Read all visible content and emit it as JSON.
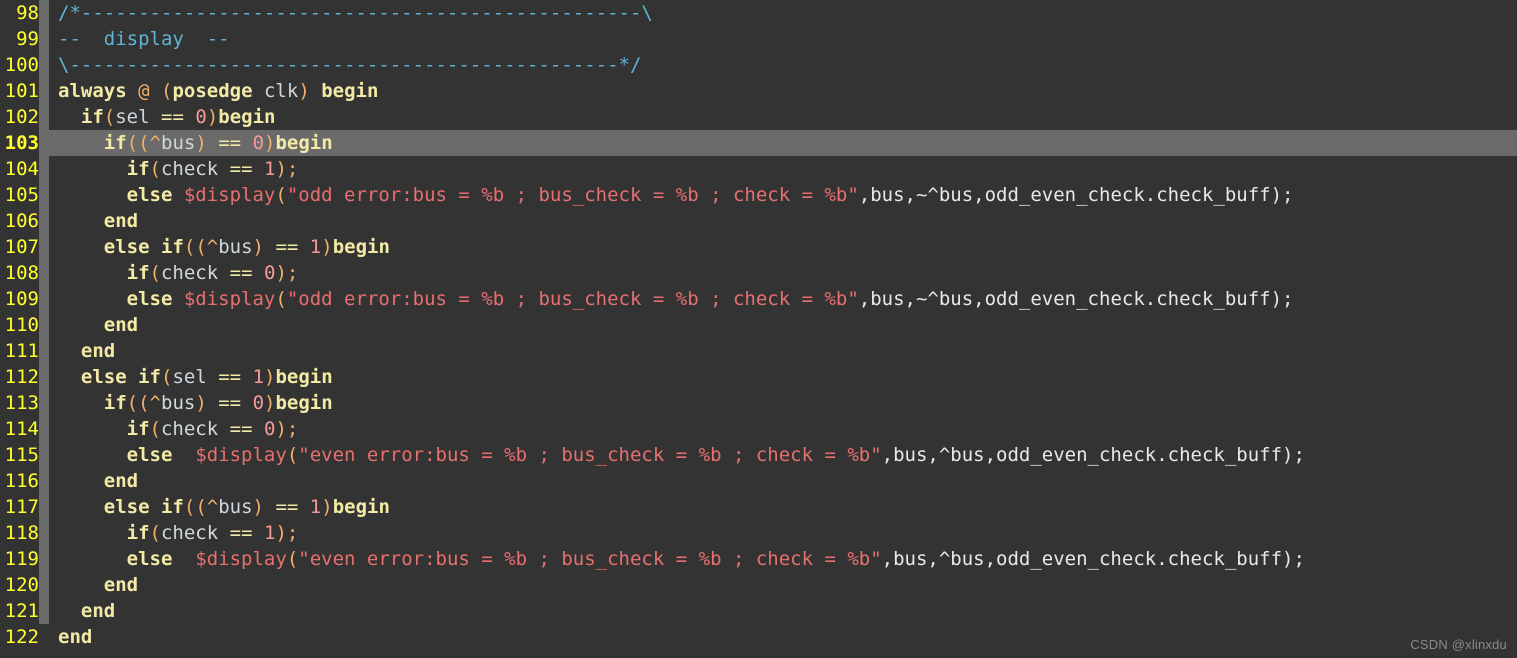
{
  "editor": {
    "title": "verilog-source-view",
    "language": "verilog",
    "first_line_number": 98,
    "current_line": 103,
    "colors": {
      "background": "#333333",
      "highlight_line": "#6a6a6a",
      "line_number": "#ffff2b",
      "fold_column": "#6a6a6a",
      "keyword": "#f3eaa5",
      "identifier": "#cfd8dc",
      "punctuation": "#f2b06a",
      "number": "#f59a9a",
      "string": "#e86f6f",
      "function": "#e86f6f",
      "comment": "#5fb3d4",
      "plain_text": "#e8e8e8",
      "watermark": "#8a8a8a"
    }
  },
  "watermark": {
    "text": "CSDN @xlinxdu"
  },
  "lines": [
    {
      "number": "98",
      "fold": true,
      "highlight": false,
      "tokens": [
        {
          "t": "/*-------------------------------------------------\\",
          "c": "cmt"
        }
      ]
    },
    {
      "number": "99",
      "fold": true,
      "highlight": false,
      "tokens": [
        {
          "t": "--  display  --",
          "c": "cmt"
        }
      ]
    },
    {
      "number": "100",
      "fold": true,
      "highlight": false,
      "tokens": [
        {
          "t": "\\------------------------------------------------*/",
          "c": "cmt"
        }
      ]
    },
    {
      "number": "101",
      "fold": true,
      "highlight": false,
      "tokens": [
        {
          "t": "always",
          "c": "kw"
        },
        {
          "t": " ",
          "c": "plain"
        },
        {
          "t": "@",
          "c": "at"
        },
        {
          "t": " ",
          "c": "plain"
        },
        {
          "t": "(",
          "c": "punc"
        },
        {
          "t": "posedge",
          "c": "kw"
        },
        {
          "t": " ",
          "c": "plain"
        },
        {
          "t": "clk",
          "c": "id"
        },
        {
          "t": ")",
          "c": "punc"
        },
        {
          "t": " ",
          "c": "plain"
        },
        {
          "t": "begin",
          "c": "kw"
        }
      ]
    },
    {
      "number": "102",
      "fold": true,
      "highlight": false,
      "tokens": [
        {
          "t": "  ",
          "c": "plain"
        },
        {
          "t": "if",
          "c": "kw"
        },
        {
          "t": "(",
          "c": "punc"
        },
        {
          "t": "sel",
          "c": "id"
        },
        {
          "t": " ",
          "c": "plain"
        },
        {
          "t": "==",
          "c": "op"
        },
        {
          "t": " ",
          "c": "plain"
        },
        {
          "t": "0",
          "c": "num"
        },
        {
          "t": ")",
          "c": "punc"
        },
        {
          "t": "begin",
          "c": "kw"
        }
      ]
    },
    {
      "number": "103",
      "fold": true,
      "highlight": true,
      "tokens": [
        {
          "t": "    ",
          "c": "plain"
        },
        {
          "t": "if",
          "c": "kw"
        },
        {
          "t": "((",
          "c": "punc"
        },
        {
          "t": "^",
          "c": "punc"
        },
        {
          "t": "bus",
          "c": "id"
        },
        {
          "t": ")",
          "c": "punc"
        },
        {
          "t": " ",
          "c": "plain"
        },
        {
          "t": "==",
          "c": "op"
        },
        {
          "t": " ",
          "c": "plain"
        },
        {
          "t": "0",
          "c": "num"
        },
        {
          "t": ")",
          "c": "punc"
        },
        {
          "t": "begin",
          "c": "kw"
        }
      ]
    },
    {
      "number": "104",
      "fold": true,
      "highlight": false,
      "tokens": [
        {
          "t": "      ",
          "c": "plain"
        },
        {
          "t": "if",
          "c": "kw"
        },
        {
          "t": "(",
          "c": "punc"
        },
        {
          "t": "check",
          "c": "id"
        },
        {
          "t": " ",
          "c": "plain"
        },
        {
          "t": "==",
          "c": "op"
        },
        {
          "t": " ",
          "c": "plain"
        },
        {
          "t": "1",
          "c": "num"
        },
        {
          "t": ");",
          "c": "punc"
        }
      ]
    },
    {
      "number": "105",
      "fold": true,
      "highlight": false,
      "tokens": [
        {
          "t": "      ",
          "c": "plain"
        },
        {
          "t": "else",
          "c": "kw"
        },
        {
          "t": " ",
          "c": "plain"
        },
        {
          "t": "$display",
          "c": "fn"
        },
        {
          "t": "(",
          "c": "punc"
        },
        {
          "t": "\"odd error:bus = %b ; bus_check = %b ; check = %b\"",
          "c": "str"
        },
        {
          "t": ",bus,~^bus,odd_even_check.check_buff);",
          "c": "plain"
        }
      ]
    },
    {
      "number": "106",
      "fold": true,
      "highlight": false,
      "tokens": [
        {
          "t": "    ",
          "c": "plain"
        },
        {
          "t": "end",
          "c": "kw"
        }
      ]
    },
    {
      "number": "107",
      "fold": true,
      "highlight": false,
      "tokens": [
        {
          "t": "    ",
          "c": "plain"
        },
        {
          "t": "else",
          "c": "kw"
        },
        {
          "t": " ",
          "c": "plain"
        },
        {
          "t": "if",
          "c": "kw"
        },
        {
          "t": "((",
          "c": "punc"
        },
        {
          "t": "^",
          "c": "punc"
        },
        {
          "t": "bus",
          "c": "id"
        },
        {
          "t": ")",
          "c": "punc"
        },
        {
          "t": " ",
          "c": "plain"
        },
        {
          "t": "==",
          "c": "op"
        },
        {
          "t": " ",
          "c": "plain"
        },
        {
          "t": "1",
          "c": "num"
        },
        {
          "t": ")",
          "c": "punc"
        },
        {
          "t": "begin",
          "c": "kw"
        }
      ]
    },
    {
      "number": "108",
      "fold": true,
      "highlight": false,
      "tokens": [
        {
          "t": "      ",
          "c": "plain"
        },
        {
          "t": "if",
          "c": "kw"
        },
        {
          "t": "(",
          "c": "punc"
        },
        {
          "t": "check",
          "c": "id"
        },
        {
          "t": " ",
          "c": "plain"
        },
        {
          "t": "==",
          "c": "op"
        },
        {
          "t": " ",
          "c": "plain"
        },
        {
          "t": "0",
          "c": "num"
        },
        {
          "t": ");",
          "c": "punc"
        }
      ]
    },
    {
      "number": "109",
      "fold": true,
      "highlight": false,
      "tokens": [
        {
          "t": "      ",
          "c": "plain"
        },
        {
          "t": "else",
          "c": "kw"
        },
        {
          "t": " ",
          "c": "plain"
        },
        {
          "t": "$display",
          "c": "fn"
        },
        {
          "t": "(",
          "c": "punc"
        },
        {
          "t": "\"odd error:bus = %b ; bus_check = %b ; check = %b\"",
          "c": "str"
        },
        {
          "t": ",bus,~^bus,odd_even_check.check_buff);",
          "c": "plain"
        }
      ]
    },
    {
      "number": "110",
      "fold": true,
      "highlight": false,
      "tokens": [
        {
          "t": "    ",
          "c": "plain"
        },
        {
          "t": "end",
          "c": "kw"
        }
      ]
    },
    {
      "number": "111",
      "fold": true,
      "highlight": false,
      "tokens": [
        {
          "t": "  ",
          "c": "plain"
        },
        {
          "t": "end",
          "c": "kw"
        }
      ]
    },
    {
      "number": "112",
      "fold": true,
      "highlight": false,
      "tokens": [
        {
          "t": "  ",
          "c": "plain"
        },
        {
          "t": "else",
          "c": "kw"
        },
        {
          "t": " ",
          "c": "plain"
        },
        {
          "t": "if",
          "c": "kw"
        },
        {
          "t": "(",
          "c": "punc"
        },
        {
          "t": "sel",
          "c": "id"
        },
        {
          "t": " ",
          "c": "plain"
        },
        {
          "t": "==",
          "c": "op"
        },
        {
          "t": " ",
          "c": "plain"
        },
        {
          "t": "1",
          "c": "num"
        },
        {
          "t": ")",
          "c": "punc"
        },
        {
          "t": "begin",
          "c": "kw"
        }
      ]
    },
    {
      "number": "113",
      "fold": true,
      "highlight": false,
      "tokens": [
        {
          "t": "    ",
          "c": "plain"
        },
        {
          "t": "if",
          "c": "kw"
        },
        {
          "t": "((",
          "c": "punc"
        },
        {
          "t": "^",
          "c": "punc"
        },
        {
          "t": "bus",
          "c": "id"
        },
        {
          "t": ")",
          "c": "punc"
        },
        {
          "t": " ",
          "c": "plain"
        },
        {
          "t": "==",
          "c": "op"
        },
        {
          "t": " ",
          "c": "plain"
        },
        {
          "t": "0",
          "c": "num"
        },
        {
          "t": ")",
          "c": "punc"
        },
        {
          "t": "begin",
          "c": "kw"
        }
      ]
    },
    {
      "number": "114",
      "fold": true,
      "highlight": false,
      "tokens": [
        {
          "t": "      ",
          "c": "plain"
        },
        {
          "t": "if",
          "c": "kw"
        },
        {
          "t": "(",
          "c": "punc"
        },
        {
          "t": "check",
          "c": "id"
        },
        {
          "t": " ",
          "c": "plain"
        },
        {
          "t": "==",
          "c": "op"
        },
        {
          "t": " ",
          "c": "plain"
        },
        {
          "t": "0",
          "c": "num"
        },
        {
          "t": ");",
          "c": "punc"
        }
      ]
    },
    {
      "number": "115",
      "fold": true,
      "highlight": false,
      "tokens": [
        {
          "t": "      ",
          "c": "plain"
        },
        {
          "t": "else",
          "c": "kw"
        },
        {
          "t": "  ",
          "c": "plain"
        },
        {
          "t": "$display",
          "c": "fn"
        },
        {
          "t": "(",
          "c": "punc"
        },
        {
          "t": "\"even error:bus = %b ; bus_check = %b ; check = %b\"",
          "c": "str"
        },
        {
          "t": ",bus,^bus,odd_even_check.check_buff);",
          "c": "plain"
        }
      ]
    },
    {
      "number": "116",
      "fold": true,
      "highlight": false,
      "tokens": [
        {
          "t": "    ",
          "c": "plain"
        },
        {
          "t": "end",
          "c": "kw"
        }
      ]
    },
    {
      "number": "117",
      "fold": true,
      "highlight": false,
      "tokens": [
        {
          "t": "    ",
          "c": "plain"
        },
        {
          "t": "else",
          "c": "kw"
        },
        {
          "t": " ",
          "c": "plain"
        },
        {
          "t": "if",
          "c": "kw"
        },
        {
          "t": "((",
          "c": "punc"
        },
        {
          "t": "^",
          "c": "punc"
        },
        {
          "t": "bus",
          "c": "id"
        },
        {
          "t": ")",
          "c": "punc"
        },
        {
          "t": " ",
          "c": "plain"
        },
        {
          "t": "==",
          "c": "op"
        },
        {
          "t": " ",
          "c": "plain"
        },
        {
          "t": "1",
          "c": "num"
        },
        {
          "t": ")",
          "c": "punc"
        },
        {
          "t": "begin",
          "c": "kw"
        }
      ]
    },
    {
      "number": "118",
      "fold": true,
      "highlight": false,
      "tokens": [
        {
          "t": "      ",
          "c": "plain"
        },
        {
          "t": "if",
          "c": "kw"
        },
        {
          "t": "(",
          "c": "punc"
        },
        {
          "t": "check",
          "c": "id"
        },
        {
          "t": " ",
          "c": "plain"
        },
        {
          "t": "==",
          "c": "op"
        },
        {
          "t": " ",
          "c": "plain"
        },
        {
          "t": "1",
          "c": "num"
        },
        {
          "t": ");",
          "c": "punc"
        }
      ]
    },
    {
      "number": "119",
      "fold": true,
      "highlight": false,
      "tokens": [
        {
          "t": "      ",
          "c": "plain"
        },
        {
          "t": "else",
          "c": "kw"
        },
        {
          "t": "  ",
          "c": "plain"
        },
        {
          "t": "$display",
          "c": "fn"
        },
        {
          "t": "(",
          "c": "punc"
        },
        {
          "t": "\"even error:bus = %b ; bus_check = %b ; check = %b\"",
          "c": "str"
        },
        {
          "t": ",bus,^bus,odd_even_check.check_buff);",
          "c": "plain"
        }
      ]
    },
    {
      "number": "120",
      "fold": true,
      "highlight": false,
      "tokens": [
        {
          "t": "    ",
          "c": "plain"
        },
        {
          "t": "end",
          "c": "kw"
        }
      ]
    },
    {
      "number": "121",
      "fold": true,
      "highlight": false,
      "tokens": [
        {
          "t": "  ",
          "c": "plain"
        },
        {
          "t": "end",
          "c": "kw"
        }
      ]
    },
    {
      "number": "122",
      "fold": false,
      "highlight": false,
      "tokens": [
        {
          "t": "end",
          "c": "kw"
        }
      ]
    }
  ]
}
